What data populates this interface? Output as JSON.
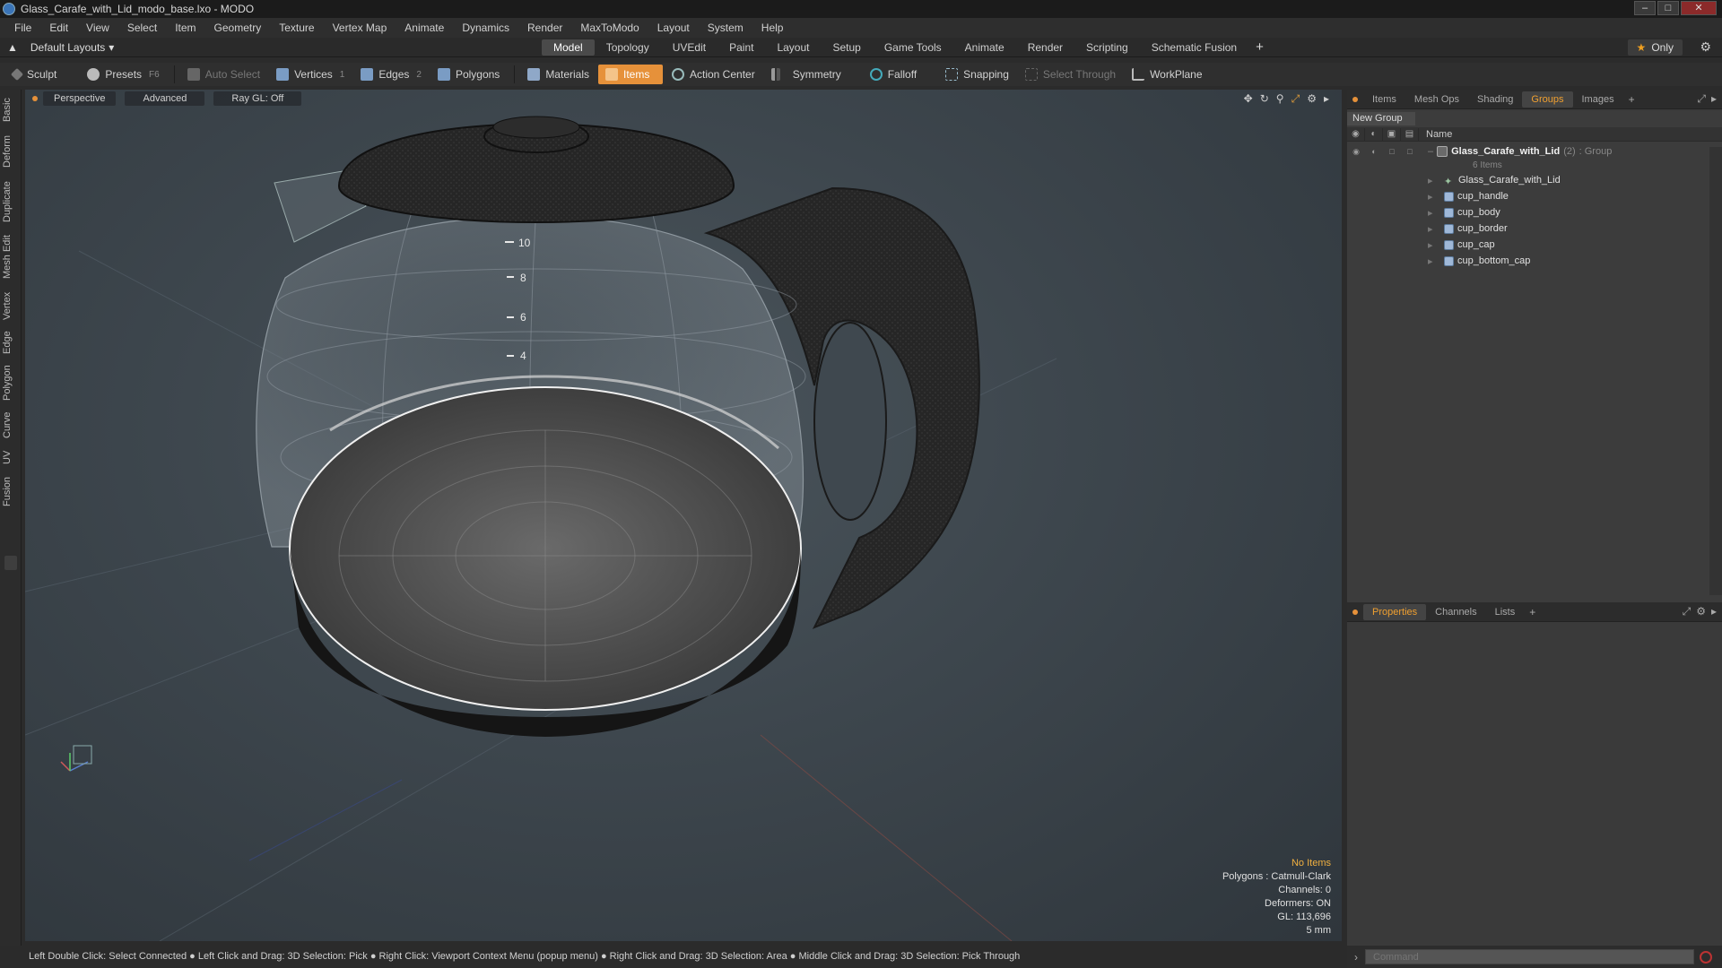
{
  "window": {
    "title": "Glass_Carafe_with_Lid_modo_base.lxo - MODO"
  },
  "menu": [
    "File",
    "Edit",
    "View",
    "Select",
    "Item",
    "Geometry",
    "Texture",
    "Vertex Map",
    "Animate",
    "Dynamics",
    "Render",
    "MaxToModo",
    "Layout",
    "System",
    "Help"
  ],
  "layouts": {
    "current": "Default Layouts",
    "tabs": [
      "Model",
      "Topology",
      "UVEdit",
      "Paint",
      "Layout",
      "Setup",
      "Game Tools",
      "Animate",
      "Render",
      "Scripting",
      "Schematic Fusion"
    ],
    "active_tab": "Model",
    "only_label": "Only"
  },
  "toolbar": {
    "sculpt": "Sculpt",
    "presets": "Presets",
    "presets_key": "F6",
    "auto_select": "Auto Select",
    "vertices": "Vertices",
    "vertices_count": "1",
    "edges": "Edges",
    "edges_count": "2",
    "polygons": "Polygons",
    "materials": "Materials",
    "items": "Items",
    "action_center": "Action Center",
    "symmetry": "Symmetry",
    "falloff": "Falloff",
    "snapping": "Snapping",
    "select_through": "Select Through",
    "workplane": "WorkPlane"
  },
  "left_tabs": [
    "Basic",
    "Deform",
    "Duplicate",
    "Mesh Edit",
    "Vertex",
    "Edge",
    "Polygon",
    "Curve",
    "UV",
    "Fusion"
  ],
  "viewport": {
    "view_mode": "Perspective",
    "shading": "Advanced",
    "raygl": "Ray GL: Off",
    "measure_marks": [
      "10",
      "8",
      "6",
      "4"
    ],
    "info": {
      "no_items": "No Items",
      "polygons": "Polygons : Catmull-Clark",
      "channels": "Channels: 0",
      "deformers": "Deformers: ON",
      "gl": "GL: 113,696",
      "scale": "5 mm"
    }
  },
  "right_panel": {
    "tabs": [
      "Items",
      "Mesh Ops",
      "Shading",
      "Groups",
      "Images"
    ],
    "active_tab": "Groups",
    "new_group": "New Group",
    "name_header": "Name",
    "group": {
      "name": "Glass_Carafe_with_Lid",
      "count": "(2)",
      "type": ": Group",
      "items_label": "6 Items"
    },
    "children": [
      "Glass_Carafe_with_Lid",
      "cup_handle",
      "cup_body",
      "cup_border",
      "cup_cap",
      "cup_bottom_cap"
    ],
    "bottom_tabs": [
      "Properties",
      "Channels",
      "Lists"
    ],
    "bottom_active": "Properties"
  },
  "command": {
    "placeholder": "Command"
  },
  "status": "Left Double Click: Select Connected ● Left Click and Drag: 3D Selection: Pick ● Right Click: Viewport Context Menu (popup menu) ● Right Click and Drag: 3D Selection: Area ● Middle Click and Drag: 3D Selection: Pick Through",
  "colors": {
    "accent": "#e6913a",
    "background": "#2b2b2b",
    "viewport": "#3d464d"
  }
}
